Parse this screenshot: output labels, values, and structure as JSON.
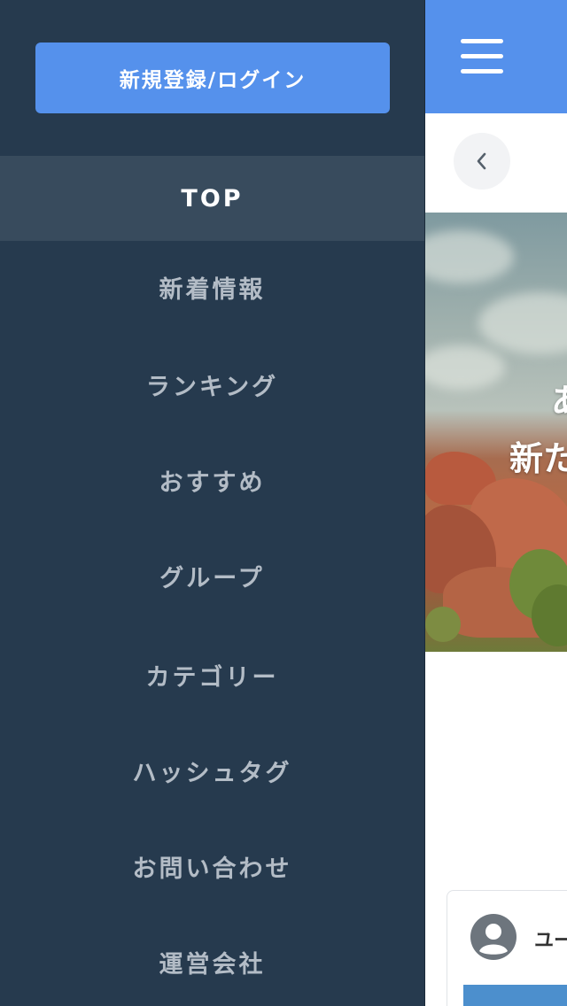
{
  "drawer": {
    "login_label": "新規登録/ログイン",
    "items": [
      {
        "label": "TOP",
        "active": true
      },
      {
        "label": "新着情報"
      },
      {
        "label": "ランキング"
      },
      {
        "label": "おすすめ"
      },
      {
        "label": "グループ"
      },
      {
        "label": "カテゴリー"
      },
      {
        "label": "ハッシュタグ"
      },
      {
        "label": "お問い合わせ"
      },
      {
        "label": "運営会社"
      }
    ]
  },
  "hero": {
    "line1": "あ",
    "line2": "新た"
  },
  "card": {
    "username": "ユー"
  },
  "colors": {
    "drawer_bg": "#263a4e",
    "drawer_active_bg": "#384b5d",
    "accent": "#5591ec",
    "nav_text": "#b3bcc6"
  }
}
